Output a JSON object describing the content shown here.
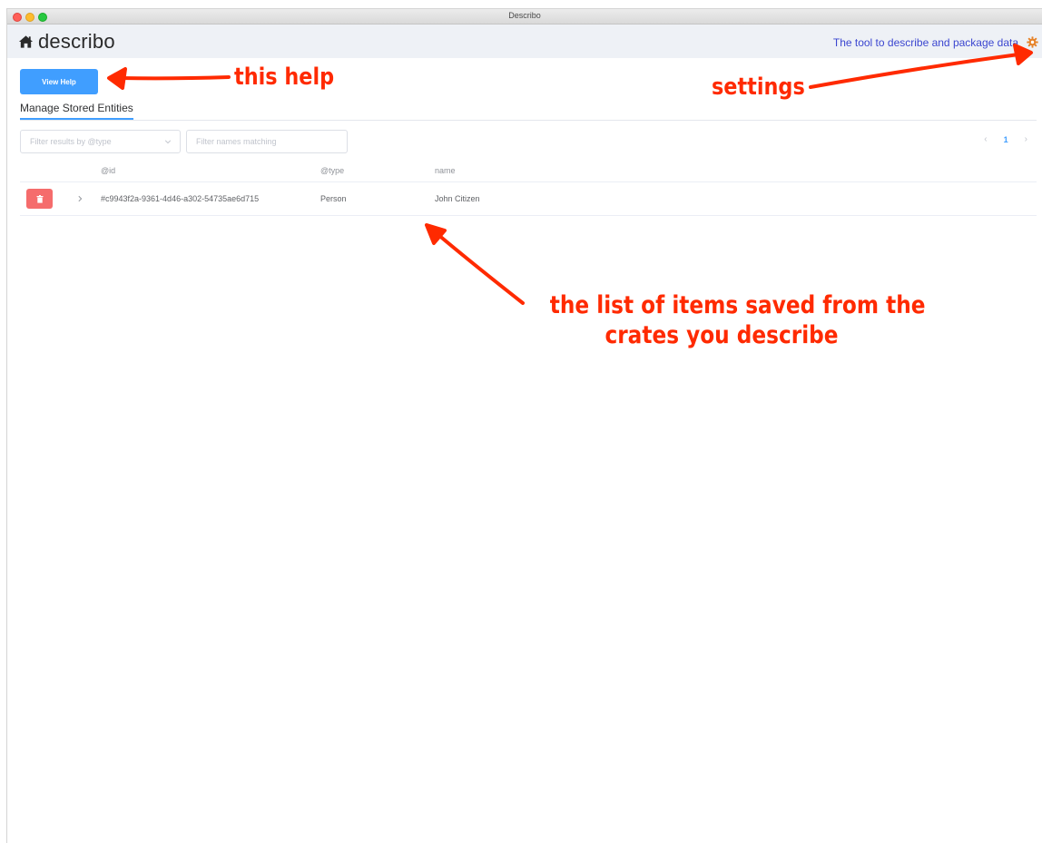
{
  "window": {
    "title": "Describo"
  },
  "header": {
    "brand": "describo",
    "tagline": "The tool to describe and package data"
  },
  "toolbar": {
    "view_help_label": "View Help"
  },
  "tabs": [
    {
      "label": "Manage Stored Entities",
      "active": true
    }
  ],
  "filters": {
    "type_placeholder": "Filter results by @type",
    "name_placeholder": "Filter names matching"
  },
  "pagination": {
    "current_page": "1",
    "prev": "‹",
    "next": "›"
  },
  "table": {
    "columns": [
      "@id",
      "@type",
      "name"
    ],
    "rows": [
      {
        "id": "#c9943f2a-9361-4d46-a302-54735ae6d715",
        "type": "Person",
        "name": "John Citizen"
      }
    ]
  },
  "annotations": {
    "help": "this help",
    "settings": "settings",
    "list_line1": "the list of items saved from the",
    "list_line2": "crates you describe"
  },
  "colors": {
    "accent": "#409eff",
    "danger": "#f56c6c",
    "tagline": "#3b46d0",
    "gear": "#e6832a",
    "annotation": "#ff2a00"
  },
  "icons": {
    "brand": "home-icon",
    "settings": "gear-icon",
    "delete": "trash-icon",
    "expand": "chevron-right-icon",
    "filter_dropdown": "chevron-down-icon"
  }
}
